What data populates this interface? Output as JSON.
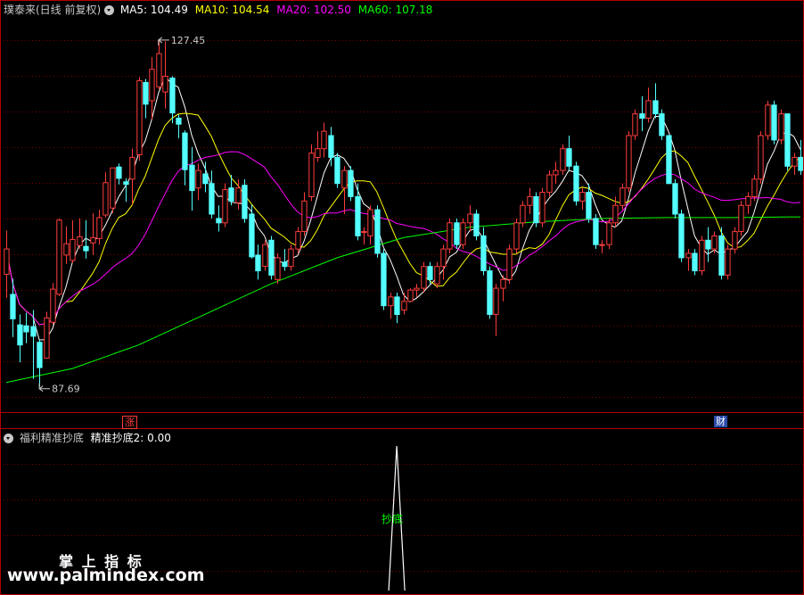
{
  "header": {
    "stock_name": "璞泰来(日线 前复权)",
    "indicators": [
      {
        "label": "MA5: 104.49",
        "color": "#ffffff"
      },
      {
        "label": "MA10: 104.54",
        "color": "#ffff00"
      },
      {
        "label": "MA20: 102.50",
        "color": "#ff00ff"
      },
      {
        "label": "MA60: 107.18",
        "color": "#00ff00"
      }
    ]
  },
  "price_annotations": {
    "high": "127.45",
    "low": "87.69"
  },
  "event_tags": {
    "rise": "涨",
    "fin": "财"
  },
  "sub_panel": {
    "title": "福利精准抄底",
    "value_label": "精准抄底2: 0.00",
    "signal_label": "抄底"
  },
  "watermark": {
    "line1": "掌 上 指 标",
    "line2": "www.palmindex.com"
  },
  "colors": {
    "up": "#ff3c3c",
    "down": "#54ffff",
    "grid": "#7a0000",
    "ma5": "#ffffff",
    "ma10": "#ffff00",
    "ma20": "#ff00ff",
    "ma60": "#00ff00",
    "signal": "#ffffff",
    "signal_label": "#00ff00"
  },
  "chart_data": {
    "type": "candlestick",
    "price_range": [
      85,
      130
    ],
    "candles": [
      [
        100.6,
        105.6,
        97.9,
        103.5
      ],
      [
        98.3,
        100.1,
        93.4,
        95.5
      ],
      [
        94.8,
        96.0,
        90.5,
        92.5
      ],
      [
        94.7,
        96.2,
        92.7,
        94.0
      ],
      [
        94.6,
        96.5,
        88.6,
        93.5
      ],
      [
        92.8,
        93.1,
        87.7,
        89.9
      ],
      [
        91.0,
        96.3,
        91.0,
        95.6
      ],
      [
        95.1,
        99.6,
        94.8,
        98.9
      ],
      [
        98.3,
        107.0,
        98.1,
        106.8
      ],
      [
        102.8,
        106.1,
        101.8,
        104.1
      ],
      [
        102.2,
        106.8,
        101.9,
        104.6
      ],
      [
        103.9,
        107.0,
        103.5,
        104.9
      ],
      [
        103.8,
        106.8,
        102.4,
        103.3
      ],
      [
        104.2,
        107.6,
        102.8,
        104.8
      ],
      [
        104.7,
        108.0,
        104.0,
        107.1
      ],
      [
        107.4,
        112.3,
        107.1,
        111.1
      ],
      [
        108.2,
        111.0,
        107.6,
        112.8
      ],
      [
        112.9,
        113.3,
        110.9,
        111.6
      ],
      [
        111.2,
        111.6,
        108.9,
        110.9
      ],
      [
        111.5,
        115.0,
        108.6,
        114.0
      ],
      [
        114.3,
        123.2,
        113.6,
        122.8
      ],
      [
        122.6,
        123.0,
        118.5,
        120.1
      ],
      [
        120.5,
        125.5,
        118.4,
        124.1
      ],
      [
        122.1,
        127.3,
        121.8,
        125.9
      ],
      [
        121.5,
        127.3,
        119.6,
        123.3
      ],
      [
        123.1,
        123.3,
        117.9,
        119.1
      ],
      [
        118.5,
        118.9,
        116.2,
        117.8
      ],
      [
        116.8,
        117.1,
        110.8,
        112.6
      ],
      [
        113.1,
        115.2,
        107.9,
        110.2
      ],
      [
        110.5,
        113.3,
        109.1,
        112.5
      ],
      [
        112.1,
        113.5,
        110.0,
        111.0
      ],
      [
        111.0,
        112.5,
        107.0,
        107.5
      ],
      [
        107.0,
        108.5,
        105.5,
        106.5
      ],
      [
        106.5,
        111.0,
        106.0,
        110.3
      ],
      [
        110.5,
        112.0,
        108.5,
        109.0
      ],
      [
        108.8,
        111.5,
        108.0,
        110.5
      ],
      [
        110.8,
        111.5,
        106.5,
        107.0
      ],
      [
        107.5,
        108.6,
        102.4,
        102.6
      ],
      [
        102.8,
        104.0,
        100.0,
        101.0
      ],
      [
        101.5,
        104.5,
        101.0,
        104.0
      ],
      [
        104.5,
        105.0,
        100.0,
        100.5
      ],
      [
        100.0,
        103.0,
        99.5,
        102.5
      ],
      [
        102.0,
        103.5,
        101.0,
        101.5
      ],
      [
        101.5,
        104.0,
        101.0,
        103.5
      ],
      [
        103.5,
        106.0,
        103.0,
        105.5
      ],
      [
        105.5,
        110.0,
        105.0,
        109.0
      ],
      [
        109.5,
        115.5,
        109.0,
        114.5
      ],
      [
        114.0,
        117.0,
        113.5,
        115.0
      ],
      [
        115.0,
        118.0,
        114.0,
        117.0
      ],
      [
        116.5,
        117.5,
        113.0,
        114.0
      ],
      [
        114.0,
        114.5,
        110.5,
        111.0
      ],
      [
        110.5,
        113.0,
        107.5,
        112.5
      ],
      [
        112.5,
        113.0,
        109.0,
        109.5
      ],
      [
        109.5,
        111.0,
        104.5,
        105.0
      ],
      [
        105.5,
        106.0,
        104.0,
        105.5
      ],
      [
        105.0,
        108.5,
        104.0,
        108.0
      ],
      [
        108.0,
        108.5,
        102.5,
        103.0
      ],
      [
        103.0,
        103.5,
        96.5,
        97.0
      ],
      [
        97.0,
        98.5,
        95.5,
        98.0
      ],
      [
        98.0,
        98.5,
        95.0,
        96.0
      ],
      [
        96.5,
        98.5,
        96.0,
        97.5
      ],
      [
        97.5,
        99.0,
        97.5,
        98.8
      ],
      [
        98.8,
        99.5,
        98.0,
        99.0
      ],
      [
        99.0,
        102.0,
        98.5,
        101.5
      ],
      [
        101.5,
        102.0,
        99.5,
        100.0
      ],
      [
        99.5,
        102.0,
        99.0,
        101.5
      ],
      [
        101.5,
        104.0,
        100.0,
        103.5
      ],
      [
        103.5,
        107.0,
        103.0,
        106.5
      ],
      [
        106.5,
        107.0,
        103.5,
        104.0
      ],
      [
        104.0,
        107.0,
        103.5,
        106.5
      ],
      [
        106.5,
        108.5,
        105.5,
        107.5
      ],
      [
        107.5,
        108.0,
        104.5,
        105.0
      ],
      [
        105.0,
        106.0,
        100.5,
        101.0
      ],
      [
        101.0,
        101.5,
        95.5,
        96.0
      ],
      [
        96.0,
        99.5,
        93.5,
        99.0
      ],
      [
        99.0,
        100.5,
        97.5,
        100.0
      ],
      [
        100.0,
        104.0,
        99.5,
        103.5
      ],
      [
        103.5,
        107.0,
        103.0,
        106.5
      ],
      [
        106.5,
        109.0,
        106.0,
        108.5
      ],
      [
        108.5,
        110.5,
        107.5,
        109.5
      ],
      [
        109.5,
        110.0,
        106.0,
        106.5
      ],
      [
        106.5,
        110.5,
        106.0,
        110.0
      ],
      [
        110.0,
        112.5,
        109.5,
        112.0
      ],
      [
        112.0,
        113.5,
        111.0,
        112.5
      ],
      [
        112.5,
        115.5,
        112.0,
        115.0
      ],
      [
        115.0,
        116.5,
        112.5,
        113.0
      ],
      [
        113.0,
        113.5,
        108.5,
        109.0
      ],
      [
        109.0,
        110.5,
        108.0,
        110.0
      ],
      [
        110.0,
        111.0,
        106.5,
        107.0
      ],
      [
        107.0,
        107.5,
        103.5,
        104.0
      ],
      [
        104.0,
        104.5,
        103.0,
        104.0
      ],
      [
        104.0,
        107.0,
        103.5,
        106.5
      ],
      [
        106.5,
        109.5,
        106.0,
        108.5
      ],
      [
        108.5,
        111.0,
        108.0,
        110.5
      ],
      [
        110.5,
        117.0,
        110.0,
        116.5
      ],
      [
        116.5,
        119.5,
        116.0,
        119.0
      ],
      [
        119.0,
        121.0,
        117.0,
        118.5
      ],
      [
        118.5,
        122.0,
        118.0,
        120.5
      ],
      [
        120.5,
        122.5,
        118.5,
        119.0
      ],
      [
        119.0,
        119.5,
        116.0,
        116.5
      ],
      [
        116.5,
        116.5,
        111.0,
        111.0
      ],
      [
        111.0,
        111.5,
        107.0,
        107.5
      ],
      [
        107.5,
        108.0,
        102.0,
        102.5
      ],
      [
        102.5,
        103.5,
        101.0,
        103.0
      ],
      [
        103.0,
        103.5,
        100.5,
        101.0
      ],
      [
        101.0,
        105.0,
        100.5,
        104.5
      ],
      [
        104.5,
        106.0,
        102.0,
        103.5
      ],
      [
        103.5,
        105.5,
        103.0,
        105.0
      ],
      [
        105.0,
        106.0,
        100.0,
        100.5
      ],
      [
        100.5,
        104.0,
        100.0,
        103.5
      ],
      [
        103.5,
        106.0,
        103.0,
        105.5
      ],
      [
        105.5,
        109.0,
        105.0,
        108.5
      ],
      [
        108.5,
        110.0,
        107.5,
        109.5
      ],
      [
        109.5,
        112.0,
        109.0,
        111.5
      ],
      [
        111.5,
        117.0,
        111.0,
        116.5
      ],
      [
        116.5,
        120.5,
        116.0,
        120.0
      ],
      [
        120.0,
        120.5,
        115.5,
        116.0
      ],
      [
        116.0,
        119.5,
        115.5,
        119.0
      ],
      [
        119.0,
        119.0,
        112.5,
        113.0
      ],
      [
        113.0,
        114.5,
        112.0,
        114.0
      ],
      [
        114.0,
        116.0,
        112.0,
        112.5
      ]
    ],
    "high_marker": {
      "value": 127.45,
      "candle": 23
    },
    "low_marker": {
      "value": 87.69,
      "candle": 5
    },
    "moving_averages": [
      "MA5",
      "MA10",
      "MA20",
      "MA60"
    ],
    "ma60_series": [
      [
        0,
        88.2
      ],
      [
        10,
        89.8
      ],
      [
        20,
        92.5
      ],
      [
        30,
        96.0
      ],
      [
        40,
        99.5
      ],
      [
        50,
        102.5
      ],
      [
        60,
        104.8
      ],
      [
        70,
        106.0
      ],
      [
        80,
        106.6
      ],
      [
        90,
        107.0
      ],
      [
        100,
        107.1
      ],
      [
        110,
        107.1
      ],
      [
        120,
        107.18
      ]
    ],
    "indicator": {
      "name": "精准抄底2",
      "signal_candle": 59
    }
  }
}
